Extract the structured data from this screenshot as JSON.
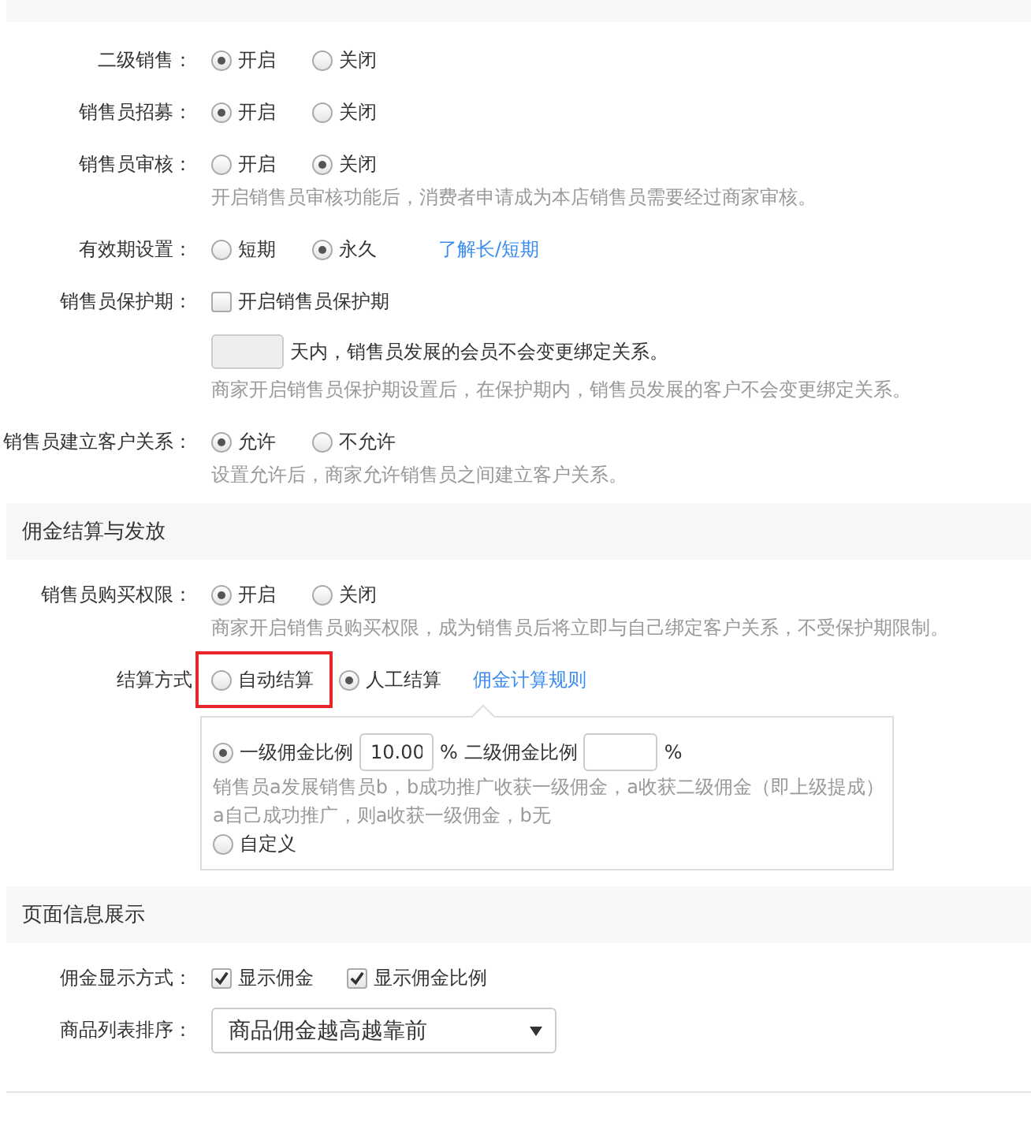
{
  "sections": [
    {
      "rows": [
        {
          "kind": "radio",
          "label": "二级销售：",
          "options": [
            {
              "label": "开启",
              "selected": true
            },
            {
              "label": "关闭",
              "selected": false
            }
          ]
        },
        {
          "kind": "radio",
          "label": "销售员招募：",
          "options": [
            {
              "label": "开启",
              "selected": true
            },
            {
              "label": "关闭",
              "selected": false
            }
          ]
        },
        {
          "kind": "radio",
          "label": "销售员审核：",
          "options": [
            {
              "label": "开启",
              "selected": false
            },
            {
              "label": "关闭",
              "selected": true
            }
          ],
          "hint": "开启销售员审核功能后，消费者申请成为本店销售员需要经过商家审核。"
        },
        {
          "kind": "radio",
          "label": "有效期设置：",
          "options": [
            {
              "label": "短期",
              "selected": false
            },
            {
              "label": "永久",
              "selected": true
            }
          ],
          "link": "了解长/短期"
        },
        {
          "kind": "protection",
          "label": "销售员保护期：",
          "checkbox": {
            "label": "开启销售员保护期",
            "checked": false
          },
          "days_text": "天内，销售员发展的会员不会变更绑定关系。",
          "hint": "商家开启销售员保护期设置后，在保护期内，销售员发展的客户不会变更绑定关系。"
        },
        {
          "kind": "radio",
          "label": "销售员建立客户关系：",
          "options": [
            {
              "label": "允许",
              "selected": true
            },
            {
              "label": "不允许",
              "selected": false
            }
          ],
          "hint": "设置允许后，商家允许销售员之间建立客户关系。"
        }
      ]
    },
    {
      "title": "佣金结算与发放",
      "rows": [
        {
          "kind": "radio",
          "label": "销售员购买权限：",
          "options": [
            {
              "label": "开启",
              "selected": true
            },
            {
              "label": "关闭",
              "selected": false
            }
          ],
          "hint": "商家开启销售员购买权限，成为销售员后将立即与自己绑定客户关系，不受保护期限制。"
        },
        {
          "kind": "radio",
          "label": "结算方式",
          "options": [
            {
              "label": "自动结算",
              "selected": false,
              "highlighted": true
            },
            {
              "label": "人工结算",
              "selected": true,
              "highlighted": false
            }
          ],
          "link": "佣金计算规则",
          "commission_box": {
            "options": [
              {
                "kind": "ratio",
                "selected": true,
                "level1_label": "一级佣金比例",
                "level1_value": "10.00",
                "level1_unit": "%",
                "level2_label": "二级佣金比例",
                "level2_unit": "%",
                "hint_lines": [
                  "销售员a发展销售员b，b成功推广收获一级佣金，a收获二级佣金（即上级提成）",
                  "a自己成功推广，则a收获一级佣金，b无"
                ]
              },
              {
                "kind": "custom",
                "selected": false,
                "label": "自定义"
              }
            ]
          }
        }
      ]
    },
    {
      "title": "页面信息展示",
      "rows": [
        {
          "kind": "checkboxes",
          "label": "佣金显示方式：",
          "options": [
            {
              "label": "显示佣金",
              "checked": true
            },
            {
              "label": "显示佣金比例",
              "checked": true
            }
          ]
        },
        {
          "kind": "select",
          "label": "商品列表排序：",
          "value": "商品佣金越高越靠前"
        }
      ]
    }
  ]
}
